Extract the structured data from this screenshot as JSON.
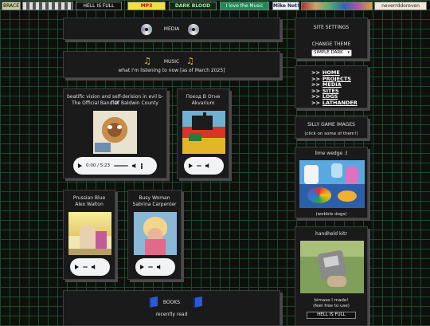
{
  "badges": {
    "b1": "BRACE",
    "b3": "HELL IS FULL",
    "b4": "MP3",
    "b5": "DARK BLOOD",
    "b6": "I love the Music",
    "b7": "Mike Not!",
    "b9": "neverrddoreven"
  },
  "media": {
    "title": "MEDIA"
  },
  "music": {
    "title": "MUSIC",
    "subtitle": "what I'm listening to now [as of March 2025]",
    "tracks": [
      {
        "line1": "beatific vision and self-derision in evil b-flat",
        "line2": "The Official Band Of Baldwin County",
        "time": "0:00 / 5:23"
      },
      {
        "line1": "Поезд В Огне",
        "line2": "Akvarium"
      },
      {
        "line1": "Prussian Blue",
        "line2": "Alex Walton"
      },
      {
        "line1": "Busy Woman",
        "line2": "Sabrina Carpenter"
      }
    ]
  },
  "books": {
    "title": "BOOKS",
    "subtitle": "recently read"
  },
  "sidebar": {
    "settings_title": "SITE SETTINGS",
    "theme_label": "CHANGE THEME",
    "theme_value": "SIMPLE DARK",
    "nav": [
      {
        "prefix": ">>",
        "label": "HOME"
      },
      {
        "prefix": ">>",
        "label": "PROJECTS"
      },
      {
        "prefix": ">>",
        "label": "MEDIA"
      },
      {
        "prefix": ">>",
        "label": "SITES"
      },
      {
        "prefix": ">>",
        "label": "LOGS"
      },
      {
        "prefix": ">>",
        "label": "LATHANDER"
      }
    ],
    "silly_title": "SILLY GAME IMAGES",
    "silly_sub": "(click on some of them!)",
    "lime_title": "lime wedge :)",
    "lime_caption": "(wobble dogs)",
    "hand_title": "handheld kitr",
    "hand_caption1": "bimase I made!",
    "hand_caption2": "(feel free to use)",
    "hand_badge": "HELL IS FULL"
  }
}
